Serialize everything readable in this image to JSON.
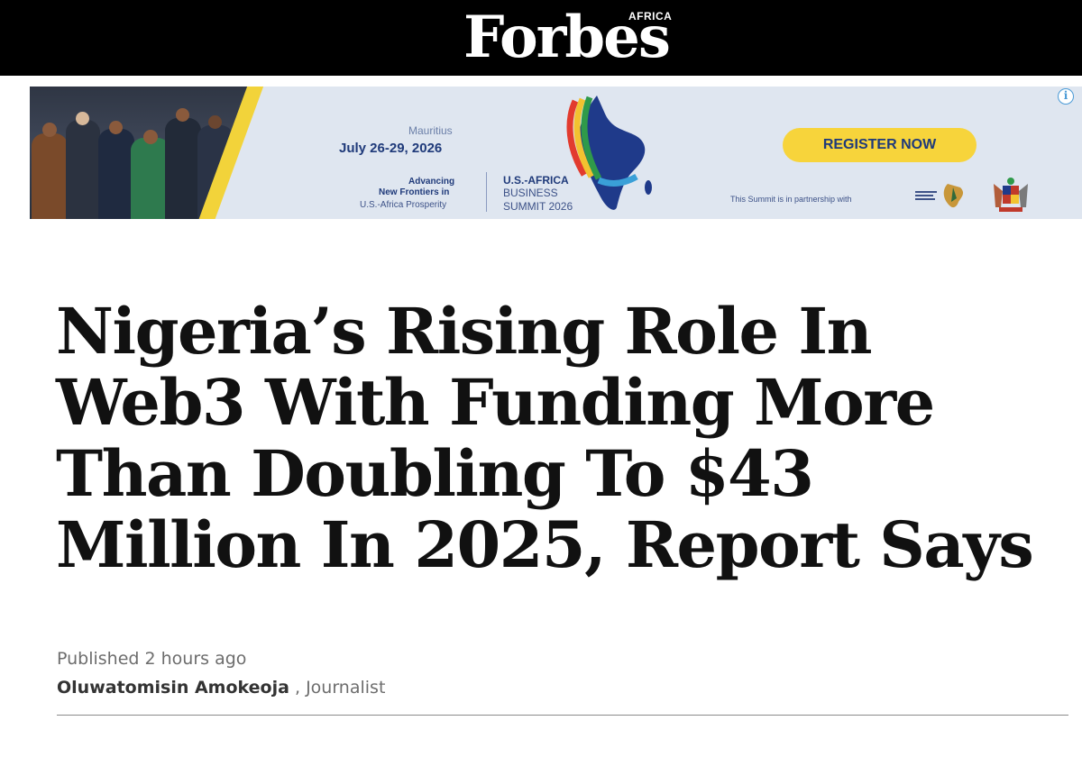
{
  "header": {
    "logo_text": "Forbes",
    "logo_edition": "AFRICA",
    "background": "#000000"
  },
  "ad": {
    "city": "Mauritius",
    "dates": "July 26-29, 2026",
    "tagline_line1": "Advancing",
    "tagline_line2": "New Frontiers in",
    "tagline_line3": "U.S.-Africa Prosperity",
    "summit_line1": "U.S.-AFRICA",
    "summit_line2": "BUSINESS",
    "summit_line3": "SUMMIT 2026",
    "cta_label": "REGISTER NOW",
    "partner_text": "This Summit is in partnership with",
    "info_icon": "i",
    "accent_color": "#f7d43b",
    "text_color": "#1f3a7a"
  },
  "article": {
    "headline": "Nigeria’s Rising Role In Web3 With Funding More Than Doubling To $43 Million In 2025, Report Says",
    "published": "Published 2 hours ago",
    "author": "Oluwatomisin Amokeoja",
    "author_separator": " , ",
    "author_role": "Journalist"
  }
}
